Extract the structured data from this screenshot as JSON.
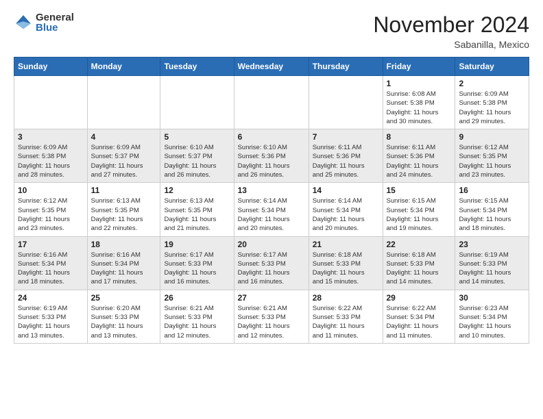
{
  "header": {
    "logo_general": "General",
    "logo_blue": "Blue",
    "month": "November 2024",
    "location": "Sabanilla, Mexico"
  },
  "weekdays": [
    "Sunday",
    "Monday",
    "Tuesday",
    "Wednesday",
    "Thursday",
    "Friday",
    "Saturday"
  ],
  "rows": [
    {
      "cells": [
        {
          "day": "",
          "info": ""
        },
        {
          "day": "",
          "info": ""
        },
        {
          "day": "",
          "info": ""
        },
        {
          "day": "",
          "info": ""
        },
        {
          "day": "",
          "info": ""
        },
        {
          "day": "1",
          "info": "Sunrise: 6:08 AM\nSunset: 5:38 PM\nDaylight: 11 hours\nand 30 minutes."
        },
        {
          "day": "2",
          "info": "Sunrise: 6:09 AM\nSunset: 5:38 PM\nDaylight: 11 hours\nand 29 minutes."
        }
      ]
    },
    {
      "cells": [
        {
          "day": "3",
          "info": "Sunrise: 6:09 AM\nSunset: 5:38 PM\nDaylight: 11 hours\nand 28 minutes."
        },
        {
          "day": "4",
          "info": "Sunrise: 6:09 AM\nSunset: 5:37 PM\nDaylight: 11 hours\nand 27 minutes."
        },
        {
          "day": "5",
          "info": "Sunrise: 6:10 AM\nSunset: 5:37 PM\nDaylight: 11 hours\nand 26 minutes."
        },
        {
          "day": "6",
          "info": "Sunrise: 6:10 AM\nSunset: 5:36 PM\nDaylight: 11 hours\nand 26 minutes."
        },
        {
          "day": "7",
          "info": "Sunrise: 6:11 AM\nSunset: 5:36 PM\nDaylight: 11 hours\nand 25 minutes."
        },
        {
          "day": "8",
          "info": "Sunrise: 6:11 AM\nSunset: 5:36 PM\nDaylight: 11 hours\nand 24 minutes."
        },
        {
          "day": "9",
          "info": "Sunrise: 6:12 AM\nSunset: 5:35 PM\nDaylight: 11 hours\nand 23 minutes."
        }
      ]
    },
    {
      "cells": [
        {
          "day": "10",
          "info": "Sunrise: 6:12 AM\nSunset: 5:35 PM\nDaylight: 11 hours\nand 23 minutes."
        },
        {
          "day": "11",
          "info": "Sunrise: 6:13 AM\nSunset: 5:35 PM\nDaylight: 11 hours\nand 22 minutes."
        },
        {
          "day": "12",
          "info": "Sunrise: 6:13 AM\nSunset: 5:35 PM\nDaylight: 11 hours\nand 21 minutes."
        },
        {
          "day": "13",
          "info": "Sunrise: 6:14 AM\nSunset: 5:34 PM\nDaylight: 11 hours\nand 20 minutes."
        },
        {
          "day": "14",
          "info": "Sunrise: 6:14 AM\nSunset: 5:34 PM\nDaylight: 11 hours\nand 20 minutes."
        },
        {
          "day": "15",
          "info": "Sunrise: 6:15 AM\nSunset: 5:34 PM\nDaylight: 11 hours\nand 19 minutes."
        },
        {
          "day": "16",
          "info": "Sunrise: 6:15 AM\nSunset: 5:34 PM\nDaylight: 11 hours\nand 18 minutes."
        }
      ]
    },
    {
      "cells": [
        {
          "day": "17",
          "info": "Sunrise: 6:16 AM\nSunset: 5:34 PM\nDaylight: 11 hours\nand 18 minutes."
        },
        {
          "day": "18",
          "info": "Sunrise: 6:16 AM\nSunset: 5:34 PM\nDaylight: 11 hours\nand 17 minutes."
        },
        {
          "day": "19",
          "info": "Sunrise: 6:17 AM\nSunset: 5:33 PM\nDaylight: 11 hours\nand 16 minutes."
        },
        {
          "day": "20",
          "info": "Sunrise: 6:17 AM\nSunset: 5:33 PM\nDaylight: 11 hours\nand 16 minutes."
        },
        {
          "day": "21",
          "info": "Sunrise: 6:18 AM\nSunset: 5:33 PM\nDaylight: 11 hours\nand 15 minutes."
        },
        {
          "day": "22",
          "info": "Sunrise: 6:18 AM\nSunset: 5:33 PM\nDaylight: 11 hours\nand 14 minutes."
        },
        {
          "day": "23",
          "info": "Sunrise: 6:19 AM\nSunset: 5:33 PM\nDaylight: 11 hours\nand 14 minutes."
        }
      ]
    },
    {
      "cells": [
        {
          "day": "24",
          "info": "Sunrise: 6:19 AM\nSunset: 5:33 PM\nDaylight: 11 hours\nand 13 minutes."
        },
        {
          "day": "25",
          "info": "Sunrise: 6:20 AM\nSunset: 5:33 PM\nDaylight: 11 hours\nand 13 minutes."
        },
        {
          "day": "26",
          "info": "Sunrise: 6:21 AM\nSunset: 5:33 PM\nDaylight: 11 hours\nand 12 minutes."
        },
        {
          "day": "27",
          "info": "Sunrise: 6:21 AM\nSunset: 5:33 PM\nDaylight: 11 hours\nand 12 minutes."
        },
        {
          "day": "28",
          "info": "Sunrise: 6:22 AM\nSunset: 5:33 PM\nDaylight: 11 hours\nand 11 minutes."
        },
        {
          "day": "29",
          "info": "Sunrise: 6:22 AM\nSunset: 5:34 PM\nDaylight: 11 hours\nand 11 minutes."
        },
        {
          "day": "30",
          "info": "Sunrise: 6:23 AM\nSunset: 5:34 PM\nDaylight: 11 hours\nand 10 minutes."
        }
      ]
    }
  ]
}
